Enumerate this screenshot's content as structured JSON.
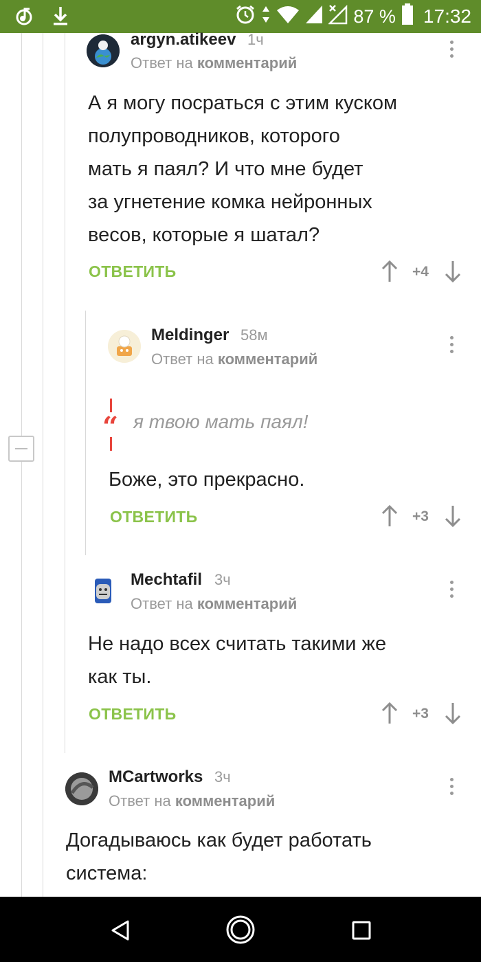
{
  "status_bar": {
    "battery": "87 %",
    "time": "17:32",
    "icons": [
      "music-note-icon",
      "download-icon",
      "alarm-icon",
      "data-arrows-icon",
      "wifi-icon",
      "signal-icon",
      "no-signal-icon",
      "battery-icon"
    ]
  },
  "comments": [
    {
      "author": "argyn.atikeev",
      "time": "1ч",
      "reply_prefix": "Ответ на",
      "reply_target": "комментарий",
      "lines": [
        "А я могу посраться с этим куском",
        "полупроводников, которого",
        "мать я паял? И что мне будет",
        "за угнетение комка нейронных",
        "весов, которые я шатал?"
      ],
      "reply_label": "ОТВЕТИТЬ",
      "rating": "+4"
    },
    {
      "author": "Meldinger",
      "time": "58м",
      "reply_prefix": "Ответ на",
      "reply_target": "комментарий",
      "quote": "я твою мать паял!",
      "lines": [
        "Боже, это прекрасно."
      ],
      "reply_label": "ОТВЕТИТЬ",
      "rating": "+3"
    },
    {
      "author": "Mechtafil",
      "time": "3ч",
      "reply_prefix": "Ответ на",
      "reply_target": "комментарий",
      "lines": [
        "Не надо всех считать такими же",
        "как ты."
      ],
      "reply_label": "ОТВЕТИТЬ",
      "rating": "+3"
    },
    {
      "author": "MCartworks",
      "time": "3ч",
      "reply_prefix": "Ответ на",
      "reply_target": "комментарий",
      "lines": [
        "Догадываюсь как будет работать",
        "система:"
      ]
    }
  ],
  "colors": {
    "status_bar": "#5f8c2a",
    "reply_button": "#8bc34a",
    "quote_accent": "#e8453c",
    "muted_text": "#9a9a9a"
  },
  "nav_bar": {
    "icons": [
      "back-icon",
      "home-icon",
      "recents-icon"
    ]
  }
}
